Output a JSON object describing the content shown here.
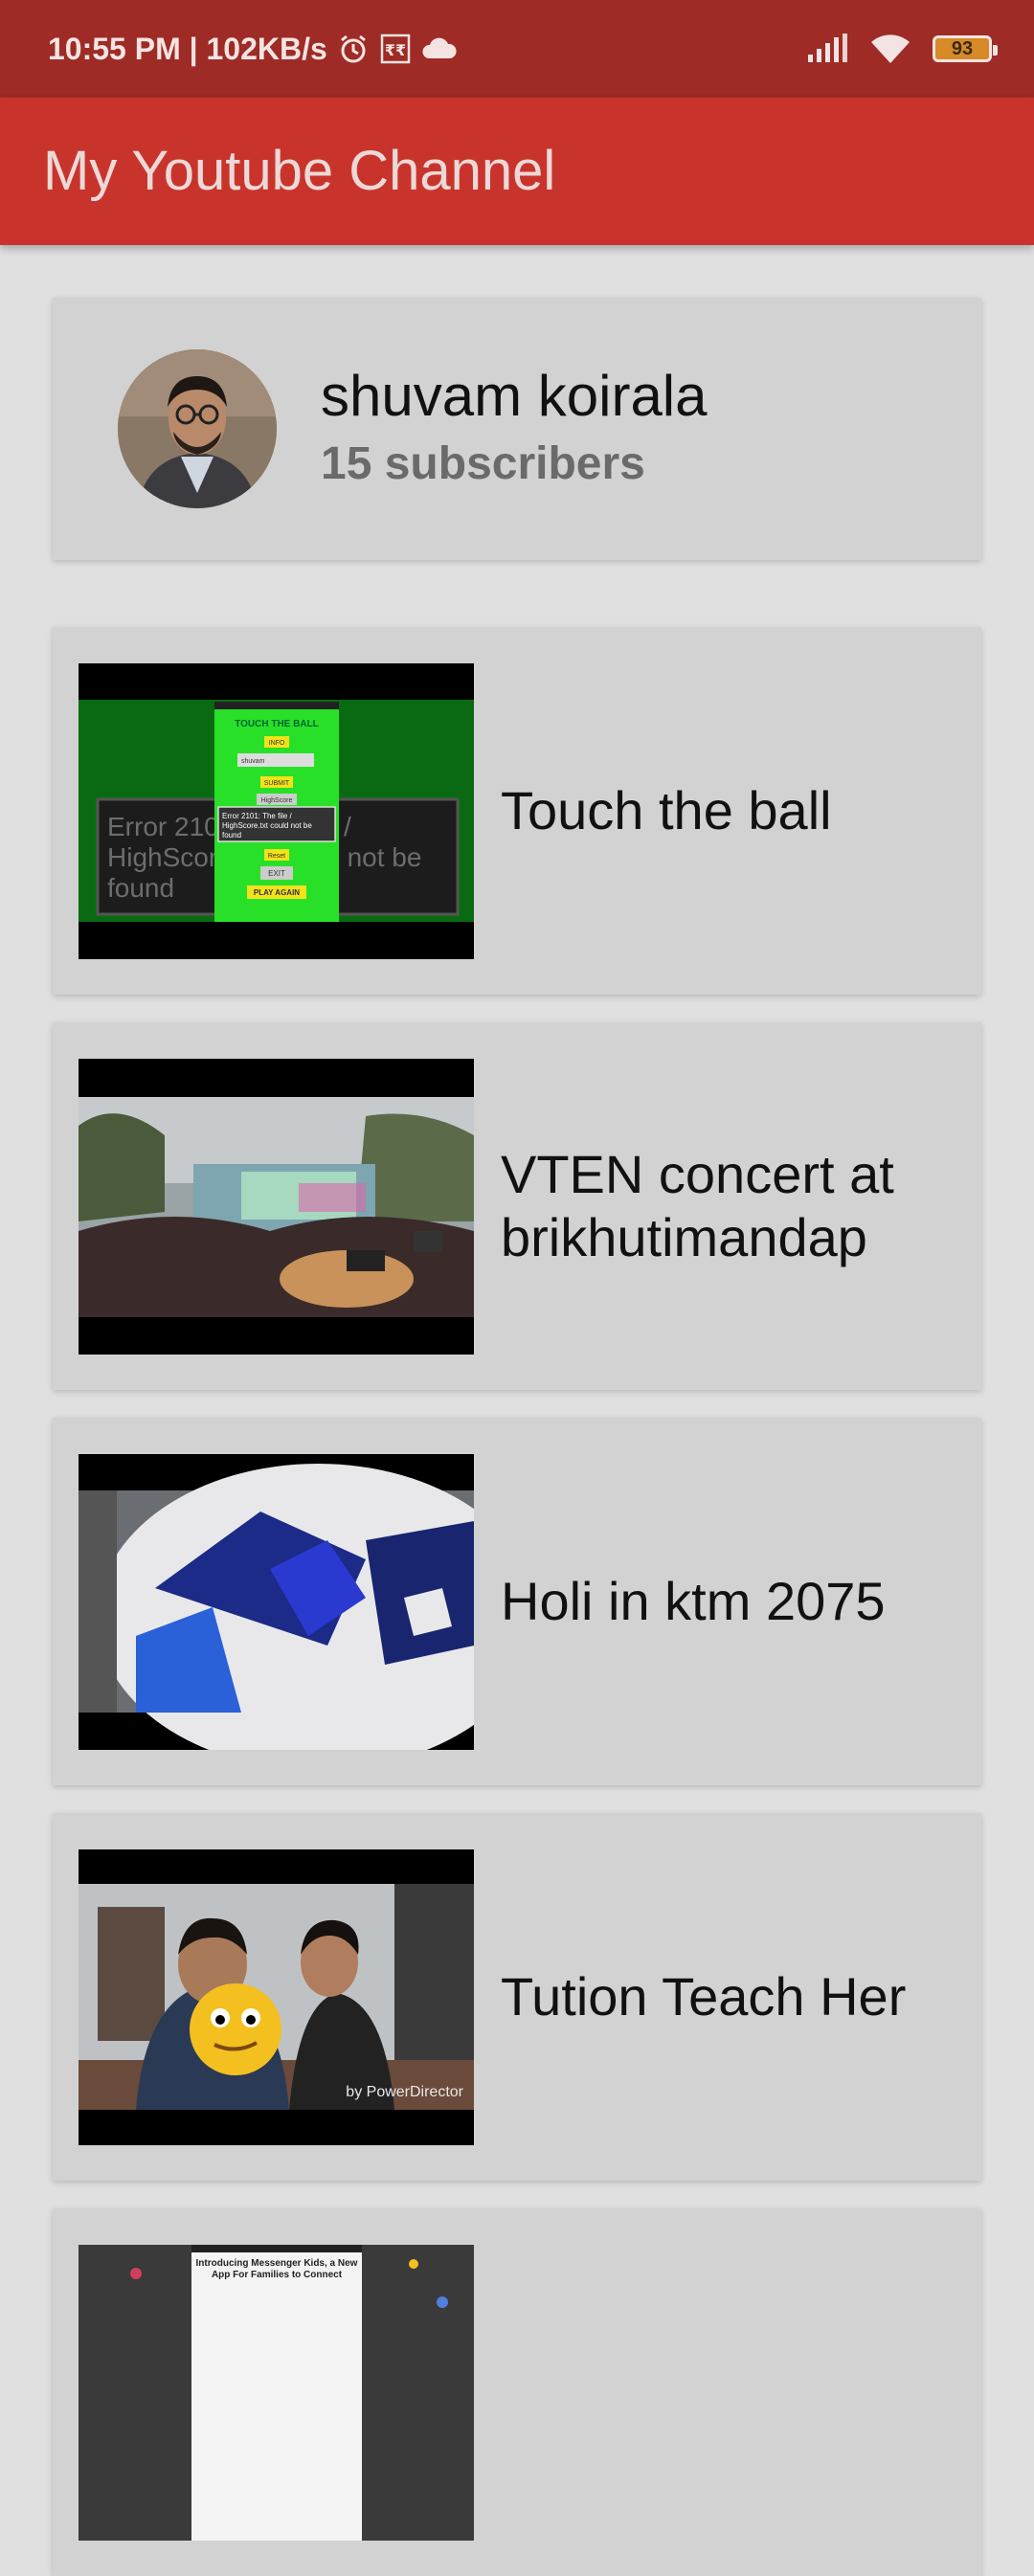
{
  "status_bar": {
    "time_speed": "10:55 PM | 102KB/s",
    "battery": "93",
    "icons": [
      "alarm-icon",
      "rupee-icon",
      "cloud-icon",
      "signal-icon",
      "wifi-icon",
      "battery-icon"
    ]
  },
  "app_bar": {
    "title": "My Youtube Channel",
    "color": "#c8342c"
  },
  "channel": {
    "name": "shuvam koirala",
    "subscribers": "15 subscribers"
  },
  "videos": [
    {
      "title": "Touch the ball",
      "thumb_text": {
        "header": "TOUCH THE BALL",
        "info": "INFO",
        "input": "shuvam",
        "submit": "SUBMIT",
        "highscore": "HighScore",
        "error": "Error 2101: The file / HighScore.txt could not be found",
        "bg_error": "Error 2101: The file / HighScore.txt could not be found",
        "reset": "Reset",
        "exit": "EXIT",
        "play_again": "PLAY AGAIN"
      }
    },
    {
      "title": "VTEN concert at brikhutimandap"
    },
    {
      "title": "Holi in ktm 2075"
    },
    {
      "title": "Tution Teach Her",
      "thumb_text": {
        "watermark": "by PowerDirector"
      }
    },
    {
      "title": "",
      "thumb_text": {
        "headline": "Introducing Messenger Kids, a New App For Families to Connect"
      }
    }
  ]
}
